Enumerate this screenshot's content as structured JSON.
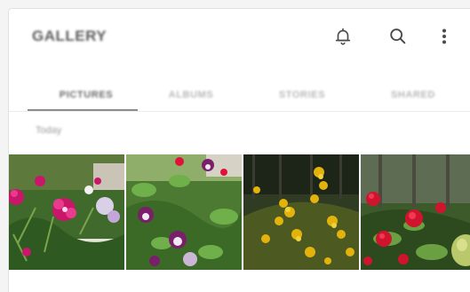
{
  "header": {
    "title": "GALLERY",
    "icons": [
      "bell-icon",
      "search-icon",
      "more-vert-icon"
    ]
  },
  "tabs": [
    {
      "label": "PICTURES",
      "active": true
    },
    {
      "label": "ALBUMS",
      "active": false
    },
    {
      "label": "STORIES",
      "active": false
    },
    {
      "label": "SHARED",
      "active": false
    }
  ],
  "section": {
    "label": "Today"
  },
  "thumbnails": [
    {
      "subject": "pink-dianthus-flowers"
    },
    {
      "subject": "columbine-flowers"
    },
    {
      "subject": "yellow-flowers"
    },
    {
      "subject": "red-flowers-and-fruit"
    }
  ],
  "colors": {
    "background": "#f4f4f4",
    "card": "#ffffff",
    "active_tab": "#6a6a6a",
    "inactive_tab": "#b8b8b8",
    "indicator": "#8c8c8c"
  }
}
